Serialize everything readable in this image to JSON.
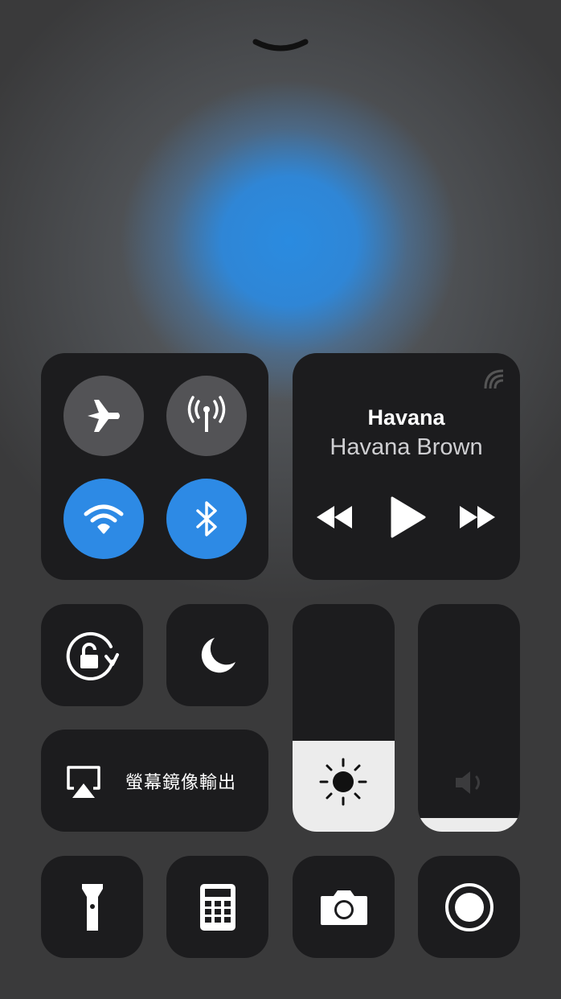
{
  "header": {
    "dismiss_icon": "chevron-down-icon"
  },
  "connectivity": {
    "airplane_mode": {
      "icon": "airplane-icon",
      "on": false
    },
    "cellular_data": {
      "icon": "antenna-icon",
      "on": false
    },
    "wifi": {
      "icon": "wifi-icon",
      "on": true
    },
    "bluetooth": {
      "icon": "bluetooth-icon",
      "on": true
    }
  },
  "now_playing": {
    "title": "Havana",
    "artist": "Havana Brown",
    "airplay_icon": "airplay-audio-icon",
    "controls": [
      "rewind-icon",
      "play-icon",
      "fast-forward-icon"
    ]
  },
  "toggles": {
    "rotation_lock": {
      "icon": "rotation-lock-icon"
    },
    "do_not_disturb": {
      "icon": "moon-icon"
    }
  },
  "screen_mirroring": {
    "label": "螢幕鏡像輸出",
    "icon": "screen-mirroring-icon"
  },
  "brightness": {
    "level": 0.4,
    "icon": "sun-icon"
  },
  "volume": {
    "level": 0.06,
    "icon": "speaker-icon"
  },
  "shortcuts": [
    "flashlight-icon",
    "calculator-icon",
    "camera-icon",
    "screen-record-icon"
  ],
  "colors": {
    "accent": "#2d8ae5",
    "tile": "#1c1c1e",
    "slider_fill": "#ececec"
  }
}
